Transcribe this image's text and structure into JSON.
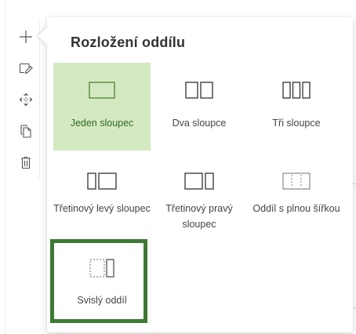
{
  "panel": {
    "title": "Rozložení oddílu"
  },
  "toolbar": {
    "items": [
      {
        "name": "add-icon"
      },
      {
        "name": "edit-icon"
      },
      {
        "name": "move-icon"
      },
      {
        "name": "duplicate-icon"
      },
      {
        "name": "delete-icon"
      }
    ]
  },
  "options": [
    {
      "label": "Jeden sloupec",
      "icon": "one-column-icon",
      "selected": true
    },
    {
      "label": "Dva sloupce",
      "icon": "two-columns-icon",
      "selected": false
    },
    {
      "label": "Tři sloupce",
      "icon": "three-columns-icon",
      "selected": false
    },
    {
      "label": "Třetinový levý sloupec",
      "icon": "one-third-left-column-icon",
      "selected": false
    },
    {
      "label": "Třetinový pravý sloupec",
      "icon": "one-third-right-column-icon",
      "selected": false
    },
    {
      "label": "Oddíl s plnou šířkou",
      "icon": "full-width-section-icon",
      "selected": false
    },
    {
      "label": "Svislý oddíl",
      "icon": "vertical-section-icon",
      "selected": false
    }
  ],
  "colors": {
    "selected_background": "#d4e9c2",
    "selected_icon_stroke": "#5b8a3a",
    "icon_stroke": "#333333",
    "highlight_frame": "#3d7a34"
  }
}
